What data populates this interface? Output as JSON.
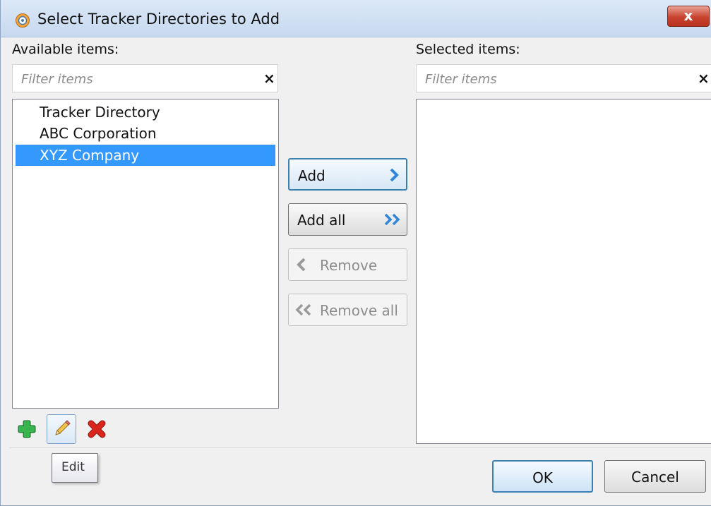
{
  "window": {
    "title": "Select Tracker Directories to Add",
    "close_label": "x"
  },
  "available": {
    "label": "Available items:",
    "filter_placeholder": "Filter items",
    "clear_label": "×",
    "items": [
      {
        "label": "Tracker Directory",
        "selected": false
      },
      {
        "label": "ABC Corporation",
        "selected": false
      },
      {
        "label": "XYZ Company",
        "selected": true
      }
    ]
  },
  "selected": {
    "label": "Selected items:",
    "filter_placeholder": "Filter items",
    "clear_label": "×",
    "items": []
  },
  "actions": {
    "add_label": "Add",
    "add_all_label": "Add all",
    "remove_label": "Remove",
    "remove_all_label": "Remove all"
  },
  "toolbar": {
    "add_icon": "plus-icon",
    "edit_icon": "pencil-icon",
    "delete_icon": "x-icon"
  },
  "tooltip": {
    "text": "Edit"
  },
  "footer": {
    "ok_label": "OK",
    "cancel_label": "Cancel"
  },
  "colors": {
    "selection": "#3399ff",
    "accent": "#2f86d9",
    "add_green": "#2ea043",
    "delete_red": "#d9261c"
  }
}
